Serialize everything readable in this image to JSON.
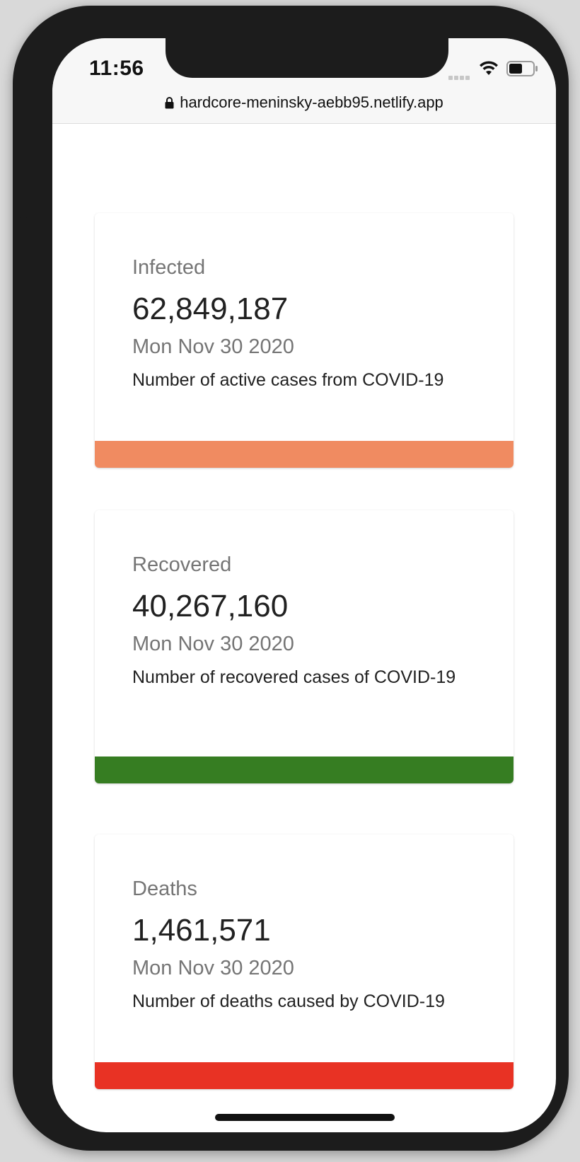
{
  "status_bar": {
    "time": "11:56",
    "url": "hardcore-meninsky-aebb95.netlify.app"
  },
  "cards": [
    {
      "title": "Infected",
      "value": "62,849,187",
      "date": "Mon Nov 30 2020",
      "description": "Number of active cases from COVID-19",
      "accent_color": "#F08B61"
    },
    {
      "title": "Recovered",
      "value": "40,267,160",
      "date": "Mon Nov 30 2020",
      "description": "Number of recovered cases of COVID-19",
      "accent_color": "#367D22"
    },
    {
      "title": "Deaths",
      "value": "1,461,571",
      "date": "Mon Nov 30 2020",
      "description": "Number of deaths caused by COVID-19",
      "accent_color": "#E83224"
    }
  ],
  "icons": [
    "lock-icon",
    "wifi-icon",
    "battery-icon",
    "signal-dots-icon"
  ]
}
